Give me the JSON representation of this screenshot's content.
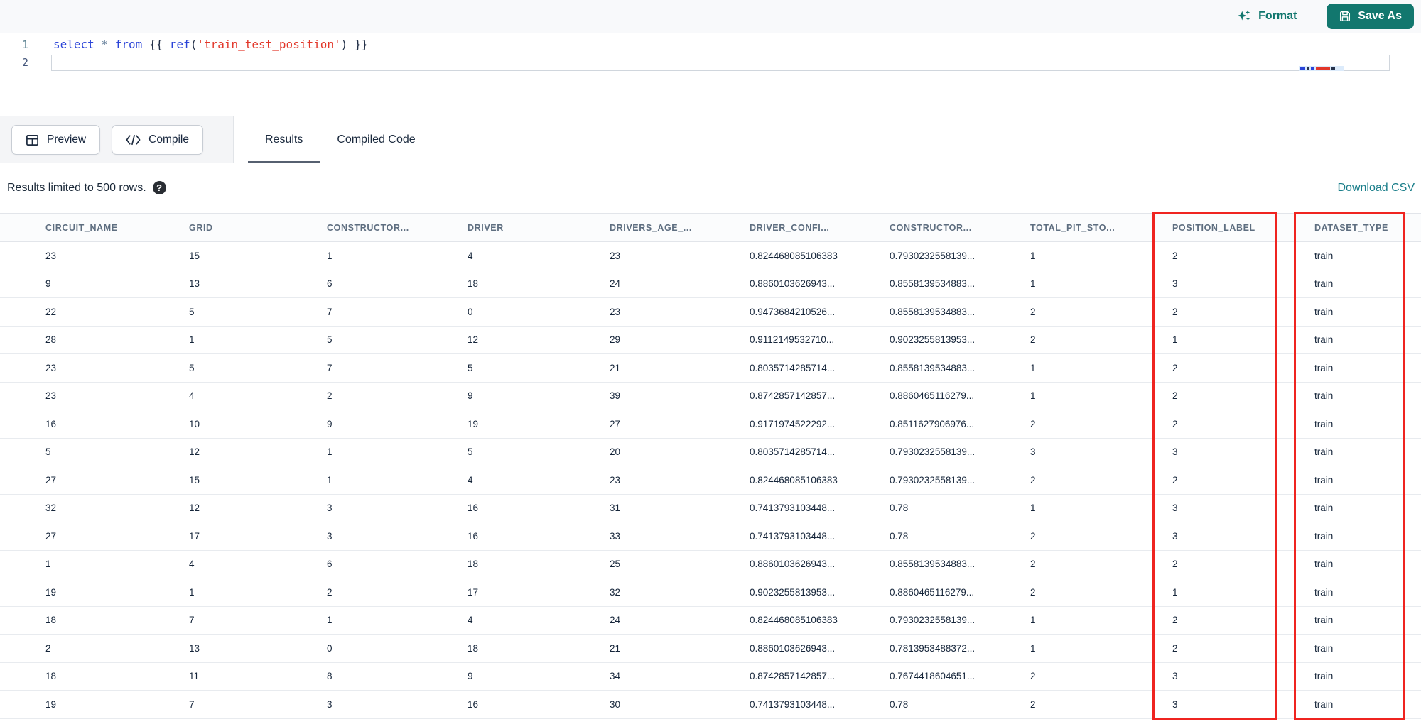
{
  "editor": {
    "line_numbers": [
      "1",
      "2"
    ],
    "code_tokens": [
      {
        "t": "select",
        "c": "kw"
      },
      {
        "t": " ",
        "c": "pl"
      },
      {
        "t": "*",
        "c": "op"
      },
      {
        "t": " ",
        "c": "pl"
      },
      {
        "t": "from",
        "c": "kw"
      },
      {
        "t": " {{ ",
        "c": "pl"
      },
      {
        "t": "ref",
        "c": "kw"
      },
      {
        "t": "(",
        "c": "pl"
      },
      {
        "t": "'train_test_position'",
        "c": "str"
      },
      {
        "t": ") }}",
        "c": "pl"
      }
    ],
    "format_label": "Format",
    "save_as_label": "Save As"
  },
  "actions": {
    "preview_label": "Preview",
    "compile_label": "Compile"
  },
  "tabs": [
    {
      "label": "Results",
      "active": true
    },
    {
      "label": "Compiled Code",
      "active": false
    }
  ],
  "results_bar": {
    "limit_text": "Results limited to 500 rows.",
    "help_glyph": "?",
    "download_label": "Download CSV"
  },
  "table": {
    "columns": [
      "CIRCUIT_NAME",
      "GRID",
      "CONSTRUCTOR...",
      "DRIVER",
      "DRIVERS_AGE_...",
      "DRIVER_CONFI...",
      "CONSTRUCTOR...",
      "TOTAL_PIT_STO...",
      "POSITION_LABEL",
      "DATASET_TYPE"
    ],
    "rows": [
      [
        "23",
        "15",
        "1",
        "4",
        "23",
        "0.824468085106383",
        "0.7930232558139...",
        "1",
        "2",
        "train"
      ],
      [
        "9",
        "13",
        "6",
        "18",
        "24",
        "0.8860103626943...",
        "0.8558139534883...",
        "1",
        "3",
        "train"
      ],
      [
        "22",
        "5",
        "7",
        "0",
        "23",
        "0.9473684210526...",
        "0.8558139534883...",
        "2",
        "2",
        "train"
      ],
      [
        "28",
        "1",
        "5",
        "12",
        "29",
        "0.9112149532710...",
        "0.9023255813953...",
        "2",
        "1",
        "train"
      ],
      [
        "23",
        "5",
        "7",
        "5",
        "21",
        "0.8035714285714...",
        "0.8558139534883...",
        "1",
        "2",
        "train"
      ],
      [
        "23",
        "4",
        "2",
        "9",
        "39",
        "0.8742857142857...",
        "0.8860465116279...",
        "1",
        "2",
        "train"
      ],
      [
        "16",
        "10",
        "9",
        "19",
        "27",
        "0.9171974522292...",
        "0.8511627906976...",
        "2",
        "2",
        "train"
      ],
      [
        "5",
        "12",
        "1",
        "5",
        "20",
        "0.8035714285714...",
        "0.7930232558139...",
        "3",
        "3",
        "train"
      ],
      [
        "27",
        "15",
        "1",
        "4",
        "23",
        "0.824468085106383",
        "0.7930232558139...",
        "2",
        "2",
        "train"
      ],
      [
        "32",
        "12",
        "3",
        "16",
        "31",
        "0.7413793103448...",
        "0.78",
        "1",
        "3",
        "train"
      ],
      [
        "27",
        "17",
        "3",
        "16",
        "33",
        "0.7413793103448...",
        "0.78",
        "2",
        "3",
        "train"
      ],
      [
        "1",
        "4",
        "6",
        "18",
        "25",
        "0.8860103626943...",
        "0.8558139534883...",
        "2",
        "2",
        "train"
      ],
      [
        "19",
        "1",
        "2",
        "17",
        "32",
        "0.9023255813953...",
        "0.8860465116279...",
        "2",
        "1",
        "train"
      ],
      [
        "18",
        "7",
        "1",
        "4",
        "24",
        "0.824468085106383",
        "0.7930232558139...",
        "1",
        "2",
        "train"
      ],
      [
        "2",
        "13",
        "0",
        "18",
        "21",
        "0.8860103626943...",
        "0.7813953488372...",
        "1",
        "2",
        "train"
      ],
      [
        "18",
        "11",
        "8",
        "9",
        "34",
        "0.8742857142857...",
        "0.7674418604651...",
        "2",
        "3",
        "train"
      ],
      [
        "19",
        "7",
        "3",
        "16",
        "30",
        "0.7413793103448...",
        "0.78",
        "2",
        "3",
        "train"
      ]
    ]
  },
  "annotations": {
    "box_color": "#ef2420",
    "boxed_columns": [
      "POSITION_LABEL",
      "DATASET_TYPE"
    ]
  },
  "colors": {
    "accent_teal": "#12776e",
    "link_teal": "#1a7e8a",
    "annotation_red": "#ef2420",
    "keyword_blue": "#2b44d8",
    "string_red": "#e2372a"
  }
}
